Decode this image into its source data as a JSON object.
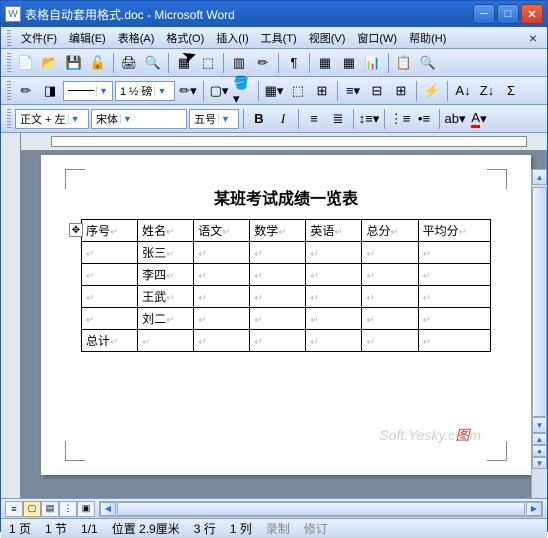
{
  "window": {
    "title": "表格自动套用格式.doc - Microsoft Word",
    "app_icon": "W"
  },
  "menu": {
    "file": "文件(F)",
    "edit": "编辑(E)",
    "table": "表格(A)",
    "format": "格式(O)",
    "insert": "插入(I)",
    "tools": "工具(T)",
    "view": "视图(V)",
    "window": "窗口(W)",
    "help": "帮助(H)"
  },
  "toolbar2": {
    "zoom_label": "1 ½ 磅"
  },
  "toolbar3": {
    "style": "正文 + 左",
    "font": "宋体",
    "size": "五号",
    "bold": "B",
    "italic": "I"
  },
  "document": {
    "title": "某班考试成绩一览表",
    "headers": [
      "序号",
      "姓名",
      "语文",
      "数学",
      "英语",
      "总分",
      "平均分"
    ],
    "rows": [
      [
        "",
        "张三",
        "",
        "",
        "",
        "",
        ""
      ],
      [
        "",
        "李四",
        "",
        "",
        "",
        "",
        ""
      ],
      [
        "",
        "王武",
        "",
        "",
        "",
        "",
        ""
      ],
      [
        "",
        "刘二",
        "",
        "",
        "",
        "",
        ""
      ],
      [
        "总计",
        "",
        "",
        "",
        "",
        "",
        ""
      ]
    ],
    "watermark1": "Soft.Yesky.c",
    "watermark2": "图",
    "watermark3": "m"
  },
  "status": {
    "page": "1 页",
    "section": "1 节",
    "pageof": "1/1",
    "position": "位置 2.9厘米",
    "line": "3 行",
    "col": "1 列",
    "rec": "录制",
    "rev": "修订"
  }
}
